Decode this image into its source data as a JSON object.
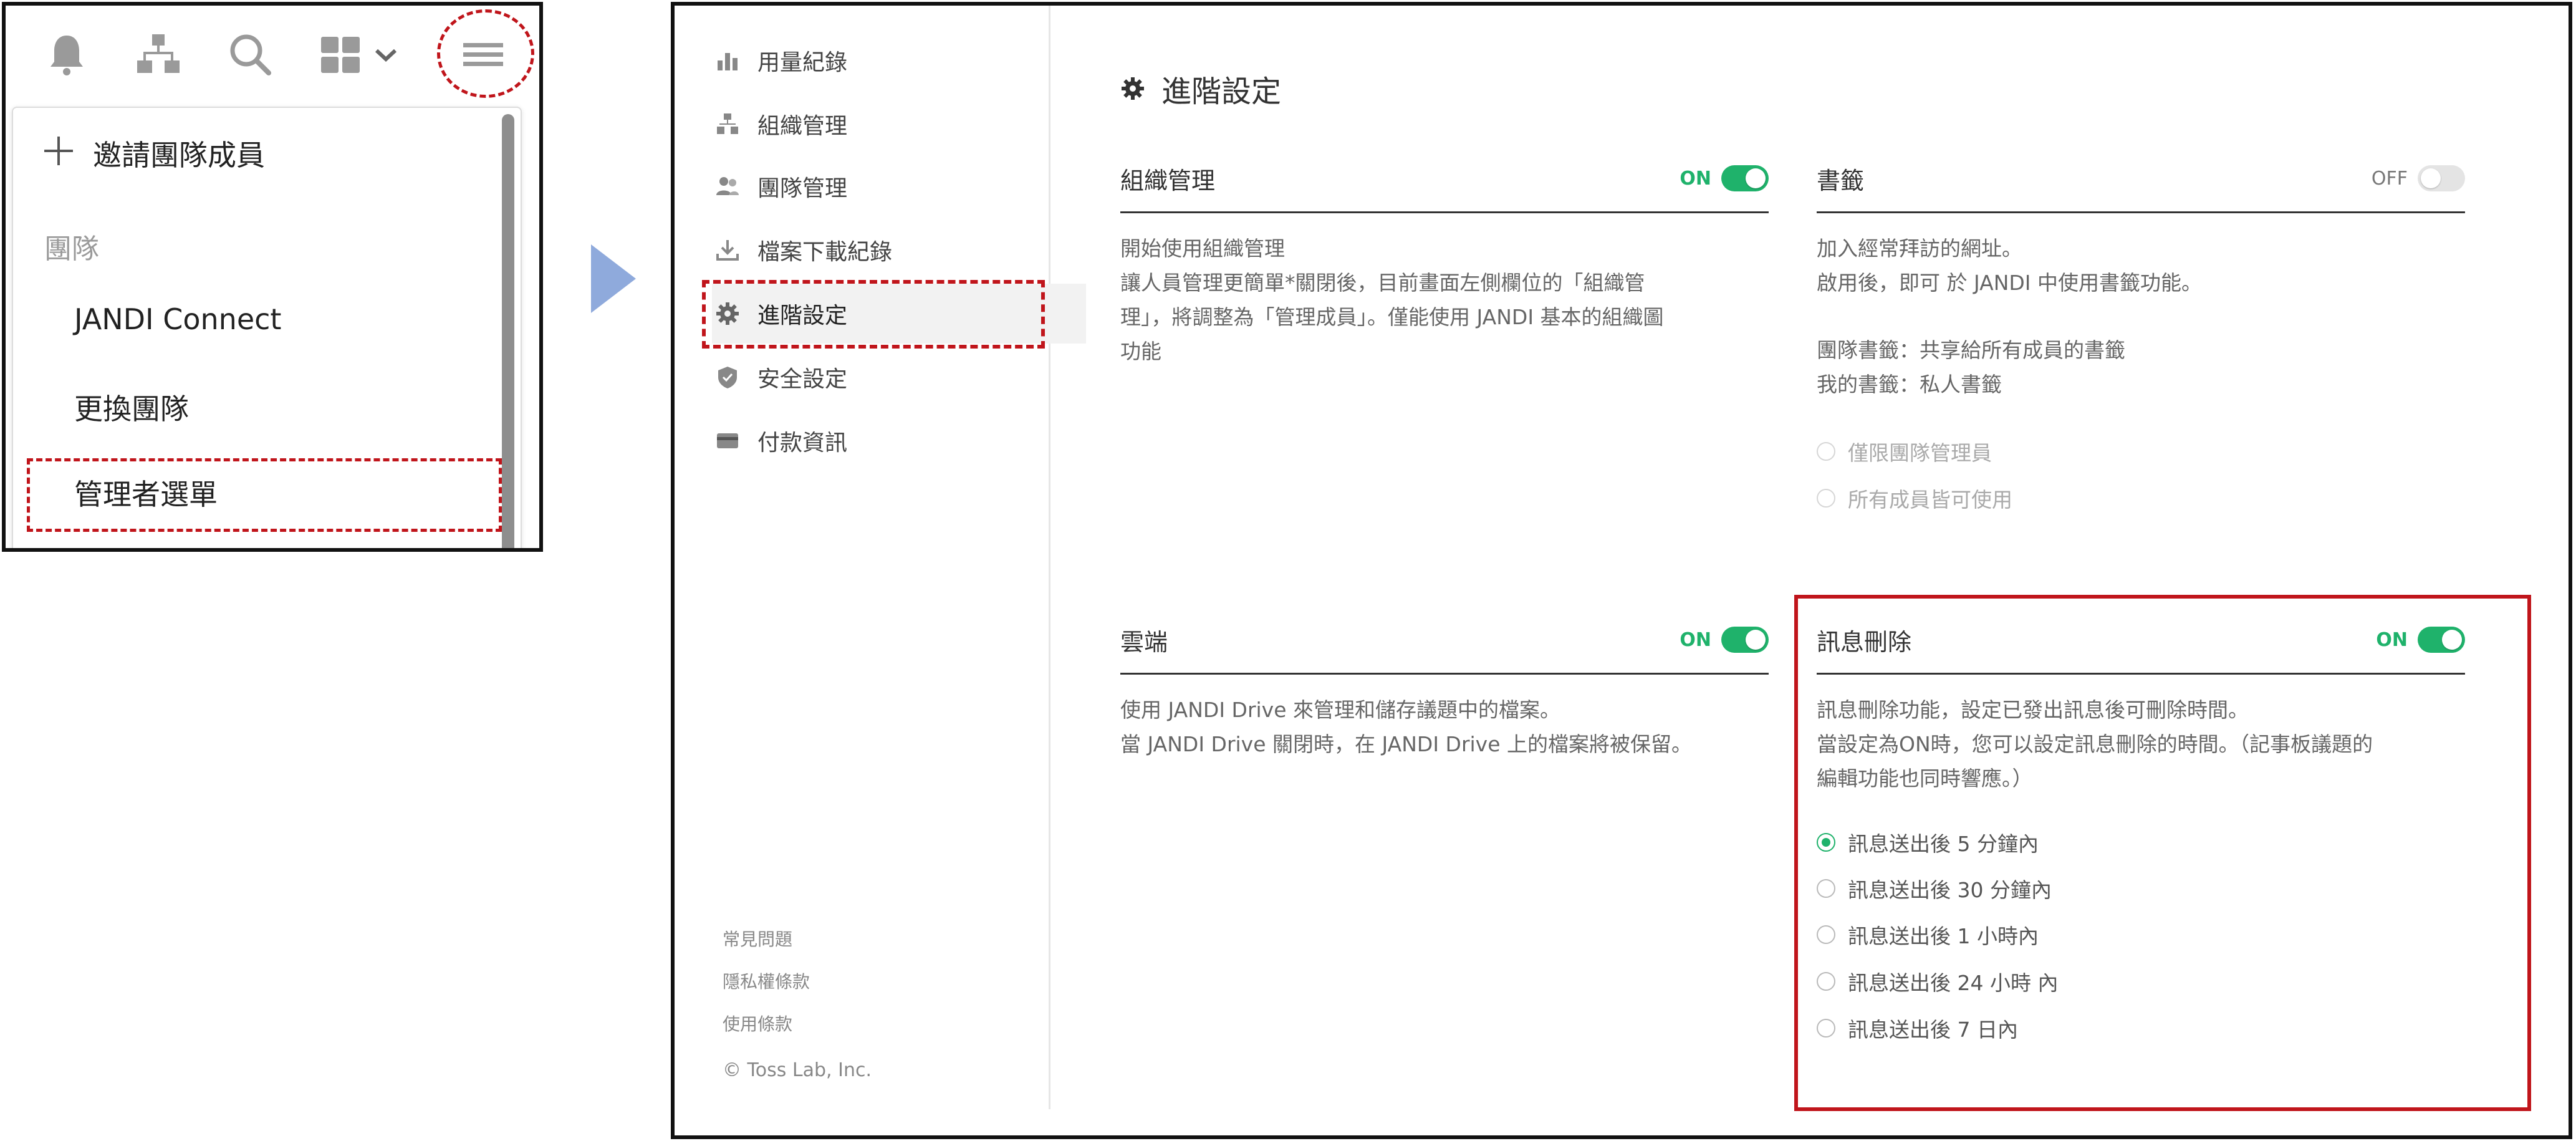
{
  "menu": {
    "icons": [
      "bell-icon",
      "org-chart-icon",
      "search-icon",
      "grid-icon",
      "chevron-down-icon",
      "hamburger-menu-icon"
    ],
    "invite_label": "邀請團隊成員",
    "section_label": "團隊",
    "items": [
      "JANDI Connect",
      "更換團隊",
      "管理者選單"
    ]
  },
  "sidebar": {
    "items": [
      {
        "label": "用量紀錄",
        "icon": "bar-chart-icon"
      },
      {
        "label": "組織管理",
        "icon": "org-chart-icon"
      },
      {
        "label": "團隊管理",
        "icon": "team-icon"
      },
      {
        "label": "檔案下載紀錄",
        "icon": "download-icon"
      },
      {
        "label": "進階設定",
        "icon": "gear-icon",
        "active": true
      },
      {
        "label": "安全設定",
        "icon": "shield-icon"
      },
      {
        "label": "付款資訊",
        "icon": "card-icon"
      }
    ],
    "footer": [
      "常見問題",
      "隱私權條款",
      "使用條款",
      "© Toss Lab, Inc."
    ]
  },
  "page": {
    "title": "進階設定"
  },
  "cards": {
    "org": {
      "title": "組織管理",
      "toggle": "ON",
      "desc": [
        "開始使用組織管理",
        "讓人員管理更簡單*關閉後，目前畫面左側欄位的「組織管",
        "理」，將調整為「管理成員」。僅能使用 JANDI 基本的組織圖",
        "功能"
      ]
    },
    "bookmark": {
      "title": "書籤",
      "toggle": "OFF",
      "desc": [
        "加入經常拜訪的網址。",
        "啟用後，即可 於 JANDI 中使用書籤功能。",
        "",
        "團隊書籤：共享給所有成員的書籤",
        "我的書籤：私人書籤"
      ],
      "options": [
        "僅限團隊管理員",
        "所有成員皆可使用"
      ]
    },
    "cloud": {
      "title": "雲端",
      "toggle": "ON",
      "desc": [
        "使用 JANDI Drive 來管理和儲存議題中的檔案。",
        "當 JANDI Drive 關閉時，在 JANDI Drive 上的檔案將被保留。"
      ]
    },
    "delete": {
      "title": "訊息刪除",
      "toggle": "ON",
      "desc": [
        "訊息刪除功能，設定已發出訊息後可刪除時間。",
        "當設定為ON時，您可以設定訊息刪除的時間。（記事板議題的",
        "編輯功能也同時響應。）"
      ],
      "options": [
        "訊息送出後 5 分鐘內",
        "訊息送出後 30 分鐘內",
        "訊息送出後 1 小時內",
        "訊息送出後 24 小時 內",
        "訊息送出後 7 日內"
      ],
      "selected_index": 0
    }
  },
  "colors": {
    "accent_green": "#1fb26b",
    "highlight_red": "#c0151b",
    "arrow_blue": "#8faadc"
  }
}
